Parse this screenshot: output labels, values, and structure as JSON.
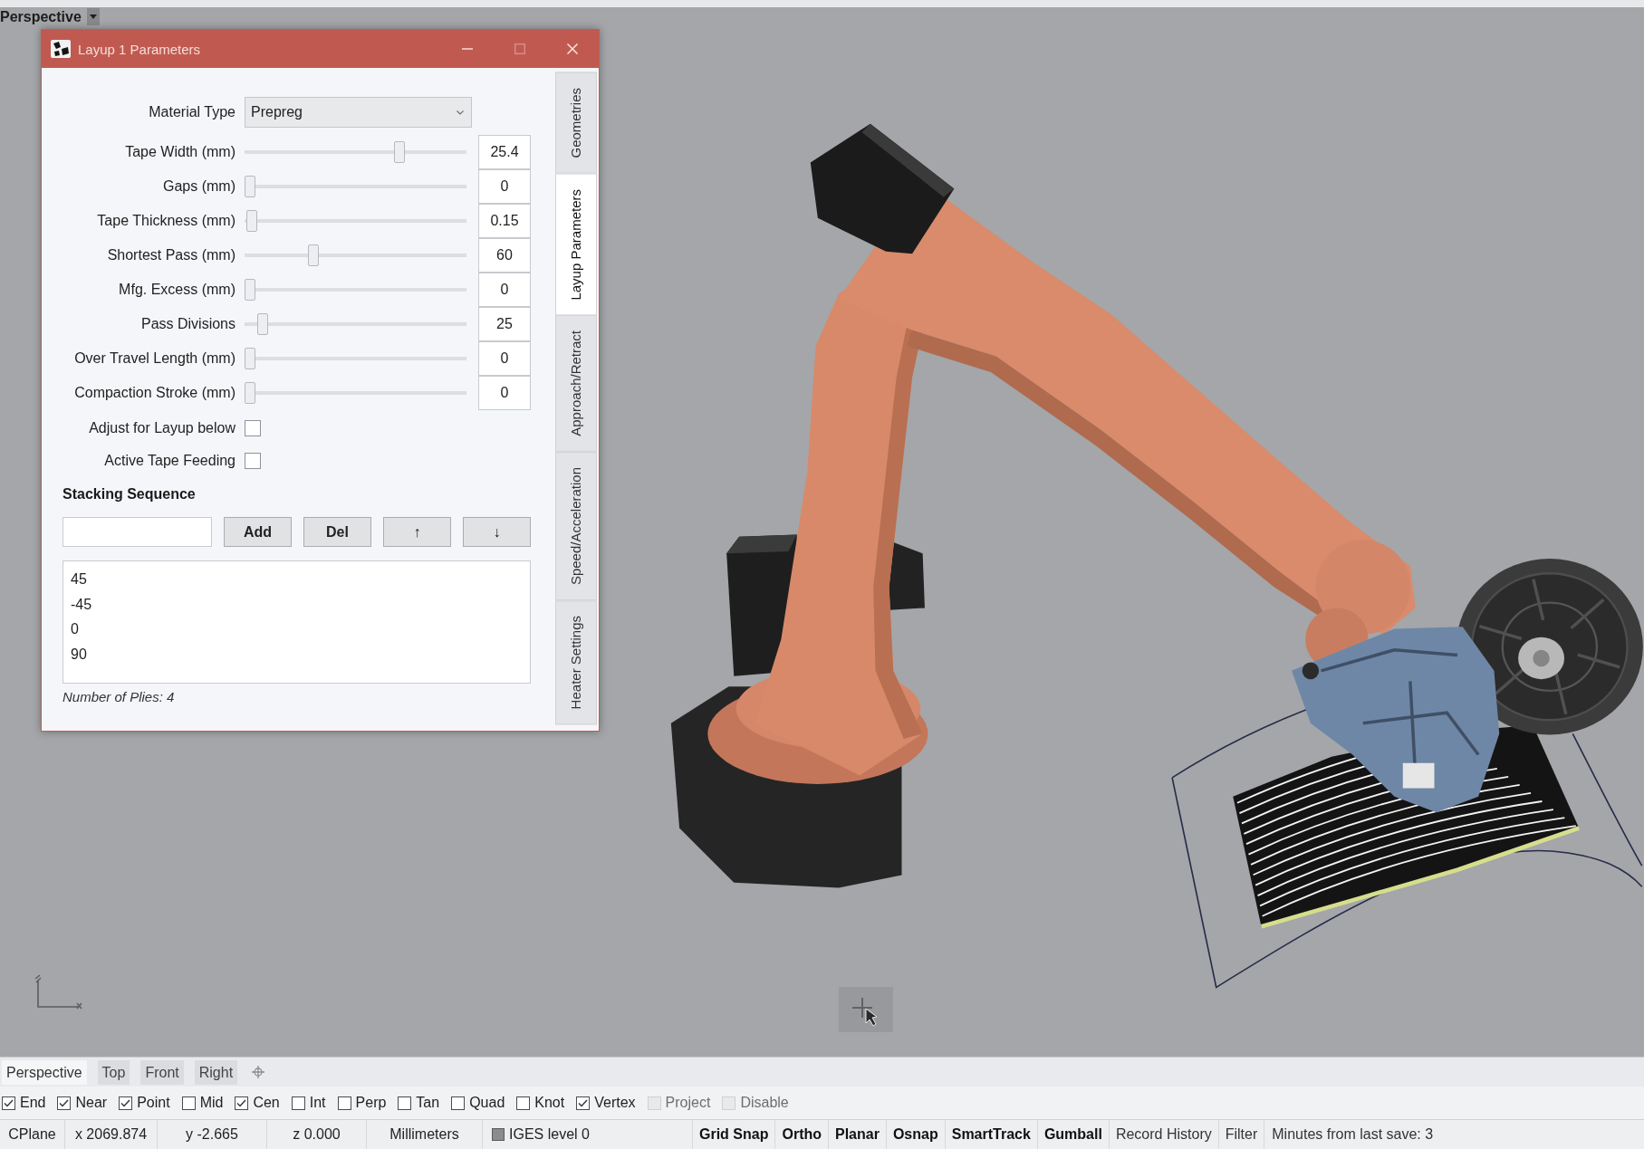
{
  "viewport": {
    "title": "Perspective"
  },
  "dialog": {
    "title": "Layup 1 Parameters",
    "caption_buttons": [
      {
        "kind": "minimize",
        "disabled": false
      },
      {
        "kind": "maximize",
        "disabled": true
      },
      {
        "kind": "close",
        "disabled": false
      }
    ],
    "material_type": {
      "label": "Material Type",
      "value": "Prepreg"
    },
    "sliders": [
      {
        "label": "Tape Width (mm)",
        "level": 0.71,
        "value": "25.4"
      },
      {
        "label": "Gaps (mm)",
        "level": 0,
        "value": "0"
      },
      {
        "label": "Tape Thickness (mm)",
        "level": 0.01,
        "value": "0.15"
      },
      {
        "label": "Shortest Pass (mm)",
        "level": 0.3,
        "value": "60"
      },
      {
        "label": "Mfg. Excess (mm)",
        "level": 0,
        "value": "0"
      },
      {
        "label": "Pass Divisions",
        "level": 0.06,
        "value": "25"
      },
      {
        "label": "Over Travel Length (mm)",
        "level": 0,
        "value": "0"
      },
      {
        "label": "Compaction Stroke (mm)",
        "level": 0,
        "value": "0"
      }
    ],
    "checkboxes": [
      {
        "label": "Adjust for Layup below",
        "checked": false
      },
      {
        "label": "Active Tape Feeding",
        "checked": false
      }
    ],
    "stacking_sequence": {
      "heading": "Stacking Sequence",
      "buttons": [
        "Add",
        "Del",
        "↑",
        "↓"
      ],
      "plies": [
        "45",
        "-45",
        "0",
        "90"
      ],
      "summary": "Number of Plies: 4"
    },
    "side_tabs": [
      {
        "label": "Geometries",
        "selected": false
      },
      {
        "label": "Layup Parameters",
        "selected": true
      },
      {
        "label": "Approach/Retract",
        "selected": false
      },
      {
        "label": "Speed/Acceleration",
        "selected": false
      },
      {
        "label": "Heater Settings",
        "selected": false
      }
    ]
  },
  "view_tabs": [
    {
      "label": "Perspective",
      "selected": true
    },
    {
      "label": "Top",
      "selected": false
    },
    {
      "label": "Front",
      "selected": false
    },
    {
      "label": "Right",
      "selected": false
    }
  ],
  "osnaps": [
    {
      "label": "End",
      "checked": true,
      "disabled": false
    },
    {
      "label": "Near",
      "checked": true,
      "disabled": false
    },
    {
      "label": "Point",
      "checked": true,
      "disabled": false
    },
    {
      "label": "Mid",
      "checked": false,
      "disabled": false
    },
    {
      "label": "Cen",
      "checked": true,
      "disabled": false
    },
    {
      "label": "Int",
      "checked": false,
      "disabled": false
    },
    {
      "label": "Perp",
      "checked": false,
      "disabled": false
    },
    {
      "label": "Tan",
      "checked": false,
      "disabled": false
    },
    {
      "label": "Quad",
      "checked": false,
      "disabled": false
    },
    {
      "label": "Knot",
      "checked": false,
      "disabled": false
    },
    {
      "label": "Vertex",
      "checked": true,
      "disabled": false
    },
    {
      "label": "Project",
      "checked": false,
      "disabled": true
    },
    {
      "label": "Disable",
      "checked": false,
      "disabled": true
    }
  ],
  "status_bar": {
    "coordinates": [
      "CPlane",
      "x 2069.874",
      "y -2.665",
      "z 0.000",
      "Millimeters"
    ],
    "layer": {
      "label": "IGES level 0",
      "color": "#8c8c8c"
    },
    "toggles": [
      {
        "label": "Grid Snap",
        "on": true
      },
      {
        "label": "Ortho",
        "on": true
      },
      {
        "label": "Planar",
        "on": true
      },
      {
        "label": "Osnap",
        "on": true
      },
      {
        "label": "SmartTrack",
        "on": true
      },
      {
        "label": "Gumball",
        "on": true
      },
      {
        "label": "Record History",
        "on": false
      },
      {
        "label": "Filter",
        "on": false
      }
    ],
    "info": "Minutes from last save: 3"
  }
}
